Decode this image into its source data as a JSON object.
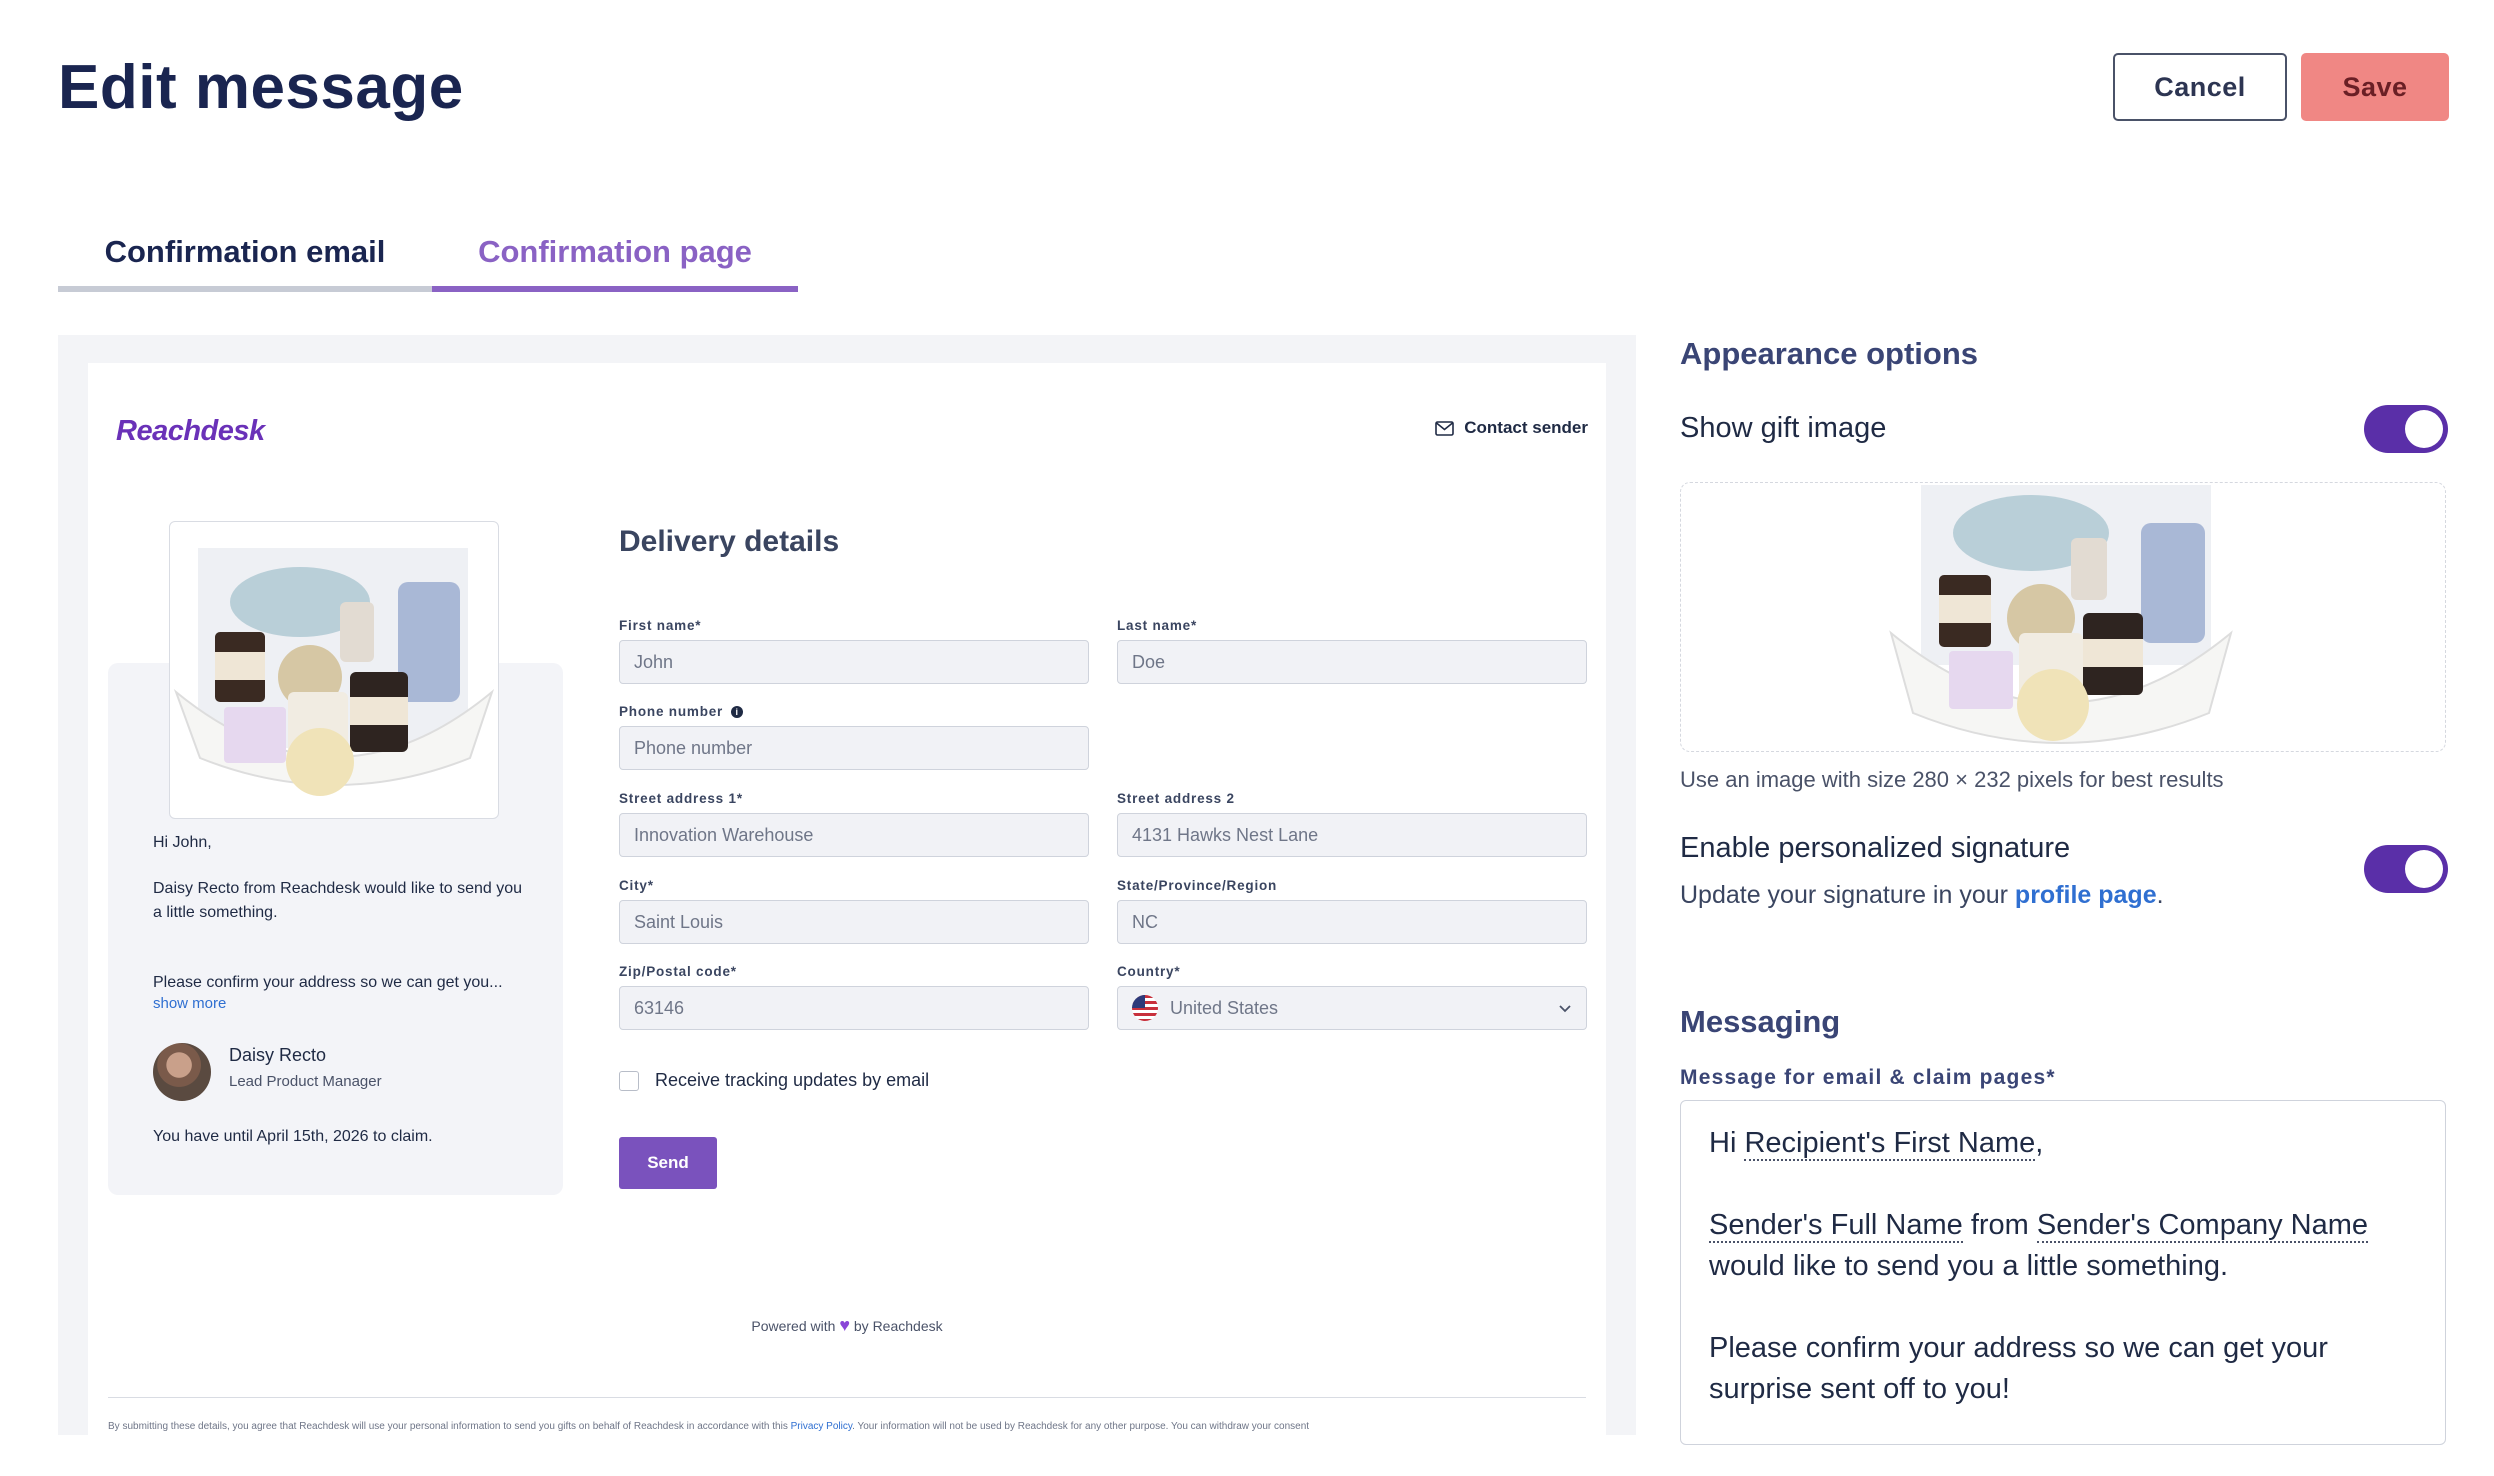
{
  "header": {
    "title": "Edit message",
    "cancel_label": "Cancel",
    "save_label": "Save"
  },
  "tabs": [
    {
      "label": "Confirmation email",
      "active": false
    },
    {
      "label": "Confirmation page",
      "active": true
    }
  ],
  "preview": {
    "logo": "Reachdesk",
    "contact_sender": "Contact sender",
    "card": {
      "greeting": "Hi John,",
      "line1": "Daisy Recto from Reachdesk would like to send you a little something.",
      "line2": "Please confirm your address so we can get you...",
      "show_more": "show more",
      "sender_name": "Daisy Recto",
      "sender_role": "Lead Product Manager",
      "deadline": "You have until April 15th, 2026 to claim."
    },
    "delivery": {
      "title": "Delivery details",
      "fields": {
        "first_name": {
          "label": "First name*",
          "value": "John"
        },
        "last_name": {
          "label": "Last name*",
          "value": "Doe"
        },
        "phone": {
          "label": "Phone number",
          "placeholder": "Phone number"
        },
        "street1": {
          "label": "Street address 1*",
          "value": "Innovation Warehouse"
        },
        "street2": {
          "label": "Street address 2",
          "value": "4131 Hawks Nest Lane"
        },
        "city": {
          "label": "City*",
          "value": "Saint Louis"
        },
        "state": {
          "label": "State/Province/Region",
          "value": "NC"
        },
        "zip": {
          "label": "Zip/Postal code*",
          "value": "63146"
        },
        "country": {
          "label": "Country*",
          "value": "United States"
        }
      },
      "tracking_label": "Receive tracking updates by email",
      "send_label": "Send"
    },
    "powered_prefix": "Powered with",
    "powered_suffix": "by Reachdesk",
    "disclaimer_start": "By submitting these details, you agree that Reachdesk will use your personal information to send you gifts on behalf of Reachdesk in accordance with this",
    "disclaimer_link": "Privacy Policy",
    "disclaimer_end": ". Your information will not be used by Reachdesk for any other purpose. You can withdraw your consent"
  },
  "appearance": {
    "title": "Appearance options",
    "show_gift_label": "Show gift image",
    "show_gift_on": true,
    "image_hint": "Use an image with size 280 × 232 pixels for best results",
    "signature_label": "Enable personalized signature",
    "signature_sub_prefix": "Update your signature in your",
    "signature_link": "profile page",
    "signature_sub_suffix": ".",
    "signature_on": true
  },
  "messaging": {
    "title": "Messaging",
    "field_label": "Message for email & claim pages*",
    "hi": "Hi",
    "token_recipient": "Recipient's First Name",
    "comma": ",",
    "token_sender": "Sender's Full Name",
    "from": "from",
    "token_company": "Sender's Company Name",
    "line2": "would like to send you a little something.",
    "line3": "Please confirm your address so we can get your surprise sent off to you!"
  },
  "colors": {
    "brand": "#6a31b8",
    "accent": "#8a62c4",
    "save": "#f08784",
    "toggle": "#5a2fa8",
    "link": "#2f6fd1"
  }
}
